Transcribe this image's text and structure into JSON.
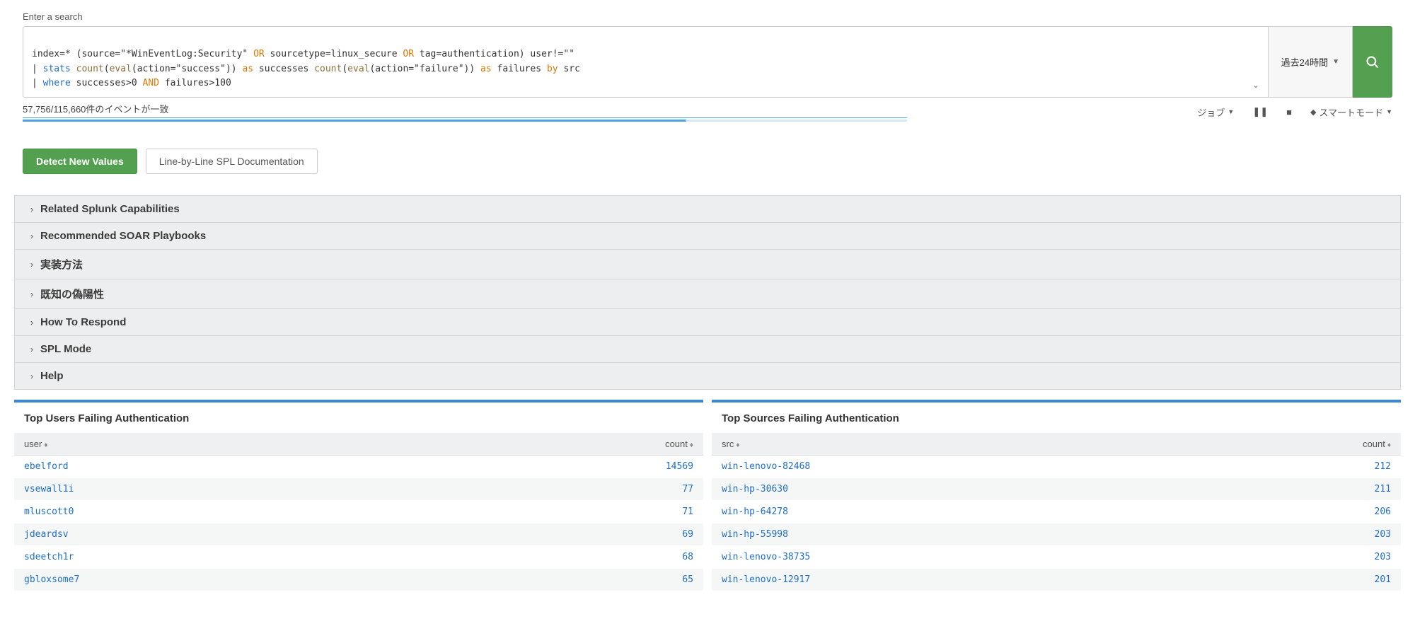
{
  "search": {
    "label": "Enter a search",
    "time_range": "過去24時間",
    "spl": {
      "line1": {
        "pre": "index=* (source=\"*WinEventLog:Security\" ",
        "or1": "OR",
        "mid1": " sourcetype=linux_secure ",
        "or2": "OR",
        "mid2": " tag=authentication) user!=\"\""
      },
      "line2": {
        "pipe": "| ",
        "cmd": "stats",
        "sp1": " ",
        "fn1": "count",
        "p1": "(",
        "fn2": "eval",
        "p2": "(action=\"success\")) ",
        "as1": "as",
        "sp2": " successes ",
        "fn3": "count",
        "p3": "(",
        "fn4": "eval",
        "p4": "(action=\"failure\")) ",
        "as2": "as",
        "sp3": " failures ",
        "by": "by",
        "tail": " src"
      },
      "line3": {
        "pipe": "| ",
        "cmd": "where",
        "sp1": " successes>0 ",
        "and": "AND",
        "tail": " failures>100"
      }
    }
  },
  "status": {
    "text": "57,756/115,660件のイベントが一致",
    "job": "ジョブ",
    "mode": "スマートモード"
  },
  "buttons": {
    "detect": "Detect New Values",
    "docs": "Line-by-Line SPL Documentation"
  },
  "accordion": [
    "Related Splunk Capabilities",
    "Recommended SOAR Playbooks",
    "実装方法",
    "既知の偽陽性",
    "How To Respond",
    "SPL Mode",
    "Help"
  ],
  "panels": {
    "users": {
      "title": "Top Users Failing Authentication",
      "col1": "user",
      "col2": "count",
      "rows": [
        {
          "k": "ebelford",
          "v": "14569"
        },
        {
          "k": "vsewall1i",
          "v": "77"
        },
        {
          "k": "mluscott0",
          "v": "71"
        },
        {
          "k": "jdeardsv",
          "v": "69"
        },
        {
          "k": "sdeetch1r",
          "v": "68"
        },
        {
          "k": "gbloxsome7",
          "v": "65"
        }
      ]
    },
    "sources": {
      "title": "Top Sources Failing Authentication",
      "col1": "src",
      "col2": "count",
      "rows": [
        {
          "k": "win-lenovo-82468",
          "v": "212"
        },
        {
          "k": "win-hp-30630",
          "v": "211"
        },
        {
          "k": "win-hp-64278",
          "v": "206"
        },
        {
          "k": "win-hp-55998",
          "v": "203"
        },
        {
          "k": "win-lenovo-38735",
          "v": "203"
        },
        {
          "k": "win-lenovo-12917",
          "v": "201"
        }
      ]
    }
  }
}
